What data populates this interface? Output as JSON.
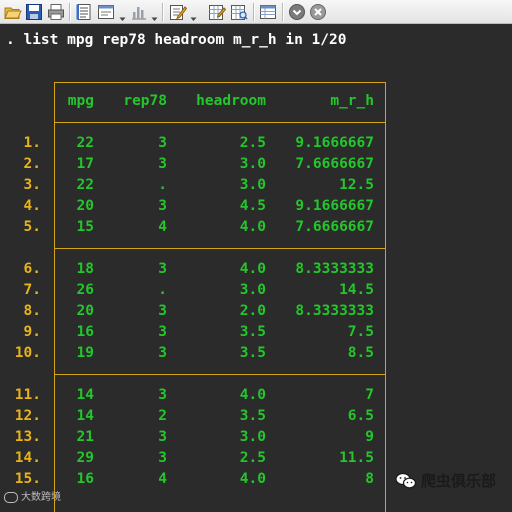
{
  "toolbar": {
    "icons": [
      "open-icon",
      "save-icon",
      "print-icon",
      "log-icon",
      "viewer-icon",
      "graph-icon",
      "do-file-editor-icon",
      "data-editor-icon",
      "data-browser-icon",
      "variables-manager-icon",
      "more-icon",
      "break-icon"
    ]
  },
  "console": {
    "command": ". list mpg rep78 headroom m_r_h in 1/20",
    "headers": {
      "mpg": "mpg",
      "rep78": "rep78",
      "headroom": "headroom",
      "mrh": "m_r_h"
    },
    "rows": [
      {
        "obs": "1.",
        "mpg": "22",
        "rep78": "3",
        "headroom": "2.5",
        "mrh": "9.1666667"
      },
      {
        "obs": "2.",
        "mpg": "17",
        "rep78": "3",
        "headroom": "3.0",
        "mrh": "7.6666667"
      },
      {
        "obs": "3.",
        "mpg": "22",
        "rep78": ".",
        "headroom": "3.0",
        "mrh": "12.5"
      },
      {
        "obs": "4.",
        "mpg": "20",
        "rep78": "3",
        "headroom": "4.5",
        "mrh": "9.1666667"
      },
      {
        "obs": "5.",
        "mpg": "15",
        "rep78": "4",
        "headroom": "4.0",
        "mrh": "7.6666667"
      },
      {
        "obs": "6.",
        "mpg": "18",
        "rep78": "3",
        "headroom": "4.0",
        "mrh": "8.3333333"
      },
      {
        "obs": "7.",
        "mpg": "26",
        "rep78": ".",
        "headroom": "3.0",
        "mrh": "14.5"
      },
      {
        "obs": "8.",
        "mpg": "20",
        "rep78": "3",
        "headroom": "2.0",
        "mrh": "8.3333333"
      },
      {
        "obs": "9.",
        "mpg": "16",
        "rep78": "3",
        "headroom": "3.5",
        "mrh": "7.5"
      },
      {
        "obs": "10.",
        "mpg": "19",
        "rep78": "3",
        "headroom": "3.5",
        "mrh": "8.5"
      },
      {
        "obs": "11.",
        "mpg": "14",
        "rep78": "3",
        "headroom": "4.0",
        "mrh": "7"
      },
      {
        "obs": "12.",
        "mpg": "14",
        "rep78": "2",
        "headroom": "3.5",
        "mrh": "6.5"
      },
      {
        "obs": "13.",
        "mpg": "21",
        "rep78": "3",
        "headroom": "3.0",
        "mrh": "9"
      },
      {
        "obs": "14.",
        "mpg": "29",
        "rep78": "3",
        "headroom": "2.5",
        "mrh": "11.5"
      },
      {
        "obs": "15.",
        "mpg": "16",
        "rep78": "4",
        "headroom": "4.0",
        "mrh": "8"
      }
    ]
  },
  "watermarks": {
    "left": "大数跨境",
    "right": "爬虫俱乐部"
  },
  "colors": {
    "background": "#2b2b2b",
    "command": "#ffffff",
    "values": "#23c72b",
    "obs_numbers": "#e8b419",
    "table_border": "#d4a417"
  }
}
